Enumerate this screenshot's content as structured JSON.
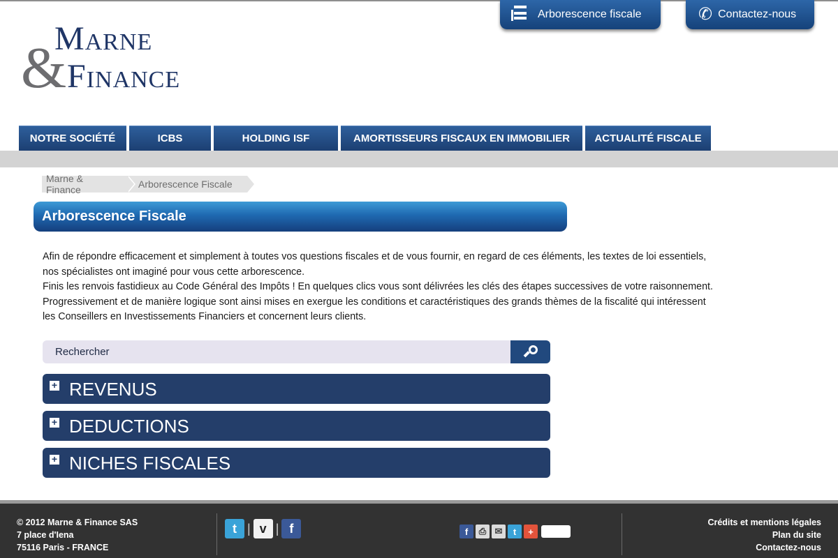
{
  "logo": {
    "amp": "&",
    "line1_cap": "M",
    "line1_rest": "ARNE",
    "line2_cap": "F",
    "line2_rest": "INANCE"
  },
  "top_buttons": {
    "tree": {
      "label": "Arborescence fiscale",
      "icon": "tree-list-icon"
    },
    "contact": {
      "label": "Contactez-nous",
      "icon": "phone-icon"
    }
  },
  "nav": {
    "items": [
      {
        "label": "NOTRE SOCIÉTÉ"
      },
      {
        "label": "ICBS"
      },
      {
        "label": "HOLDING ISF"
      },
      {
        "label": "AMORTISSEURS FISCAUX EN IMMOBILIER"
      },
      {
        "label": "ACTUALITÉ FISCALE"
      }
    ]
  },
  "breadcrumb": [
    "Marne & Finance",
    "Arborescence Fiscale"
  ],
  "page_title": "Arborescence Fiscale",
  "intro": {
    "lines": [
      "Afin de répondre efficacement et simplement à toutes vos questions fiscales et de vous fournir, en regard de ces éléments, les textes de loi essentiels,",
      "nos spécialistes ont imaginé pour vous cette arborescence.",
      "Finis les renvois fastidieux au Code Général des Impôts ! En quelques clics vous sont délivrées les clés des étapes successives de votre raisonnement.",
      "Progressivement et de manière logique sont ainsi mises en exergue les conditions et caractéristiques des grands thèmes de la fiscalité qui intéressent",
      "les Conseillers en Investissements Financiers et concernent leurs clients."
    ]
  },
  "search": {
    "placeholder": "Rechercher",
    "value": "",
    "icon": "search-icon"
  },
  "accordion": [
    {
      "label": "REVENUS",
      "toggle": "+"
    },
    {
      "label": "DEDUCTIONS",
      "toggle": "+"
    },
    {
      "label": "NICHES FISCALES",
      "toggle": "+"
    }
  ],
  "footer": {
    "address": [
      "© 2012 Marne & Finance SAS",
      "7 place d'Iena",
      "75116 Paris - FRANCE"
    ],
    "social": {
      "twitter": "t",
      "viadeo": "v",
      "facebook": "f",
      "separator": "|"
    },
    "share": {
      "facebook": "f",
      "print": "⎙",
      "email": "✉",
      "twitter": "t",
      "more": "+"
    },
    "links": [
      "Crédits et mentions légales",
      "Plan du site",
      "Contactez-nous"
    ]
  },
  "colors": {
    "brand_navy": "#1f3566",
    "accordion_bg": "#243e6a",
    "nav_bg": "#2e5f9c",
    "footer_bg": "#323232"
  }
}
